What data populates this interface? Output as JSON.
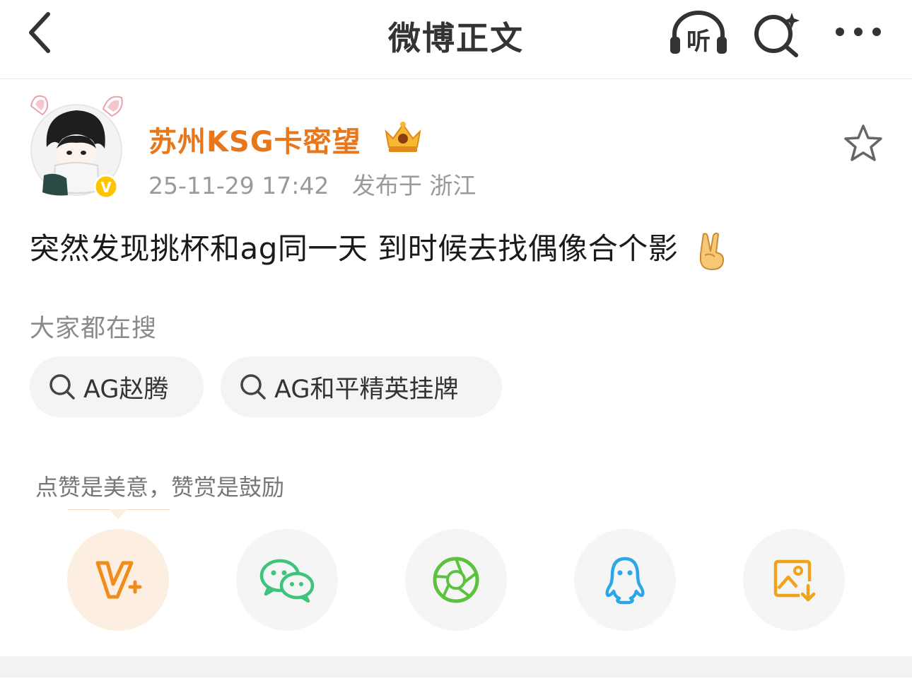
{
  "nav": {
    "title": "微博正文",
    "listen_label": "听"
  },
  "author": {
    "name": "苏州KSG卡密望",
    "timestamp": "25-11-29 17:42",
    "source": "发布于 浙江",
    "verified_badge": "V"
  },
  "post": {
    "text": "突然发现挑杯和ag同一天 到时候去找偶像合个影",
    "emoji": "victory-hand-emoji"
  },
  "hot_search": {
    "title": "大家都在搜",
    "chips": [
      {
        "label": "AG赵腾"
      },
      {
        "label": "AG和平精英挂牌"
      }
    ]
  },
  "reward": {
    "hint": "点赞是美意，赞赏是鼓励"
  },
  "share": {
    "items": [
      {
        "icon": "reward-v-icon",
        "color": "#f08c1a"
      },
      {
        "icon": "wechat-icon",
        "color": "#3dc37a"
      },
      {
        "icon": "moments-icon",
        "color": "#5cc13c"
      },
      {
        "icon": "qq-icon",
        "color": "#2ba7e8"
      },
      {
        "icon": "save-image-icon",
        "color": "#f0a21a"
      }
    ]
  },
  "colors": {
    "accent": "#e8761a",
    "meta": "#9a9a9a",
    "chip_bg": "#f4f4f4"
  }
}
